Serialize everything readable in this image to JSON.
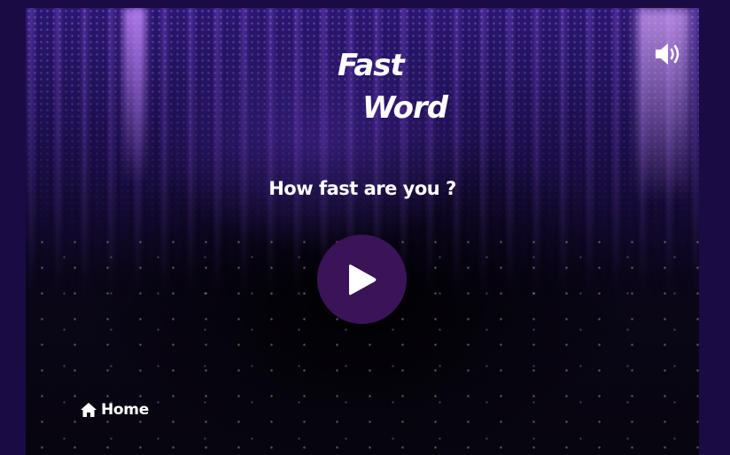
{
  "game": {
    "title_line1": "Fast",
    "title_line2": "Word",
    "tagline": "How fast are you ?"
  },
  "controls": {
    "play_icon": "play-icon",
    "sound_icon": "volume-icon",
    "home_icon": "home-icon",
    "home_label": "Home"
  },
  "colors": {
    "background": "#1a0b45",
    "play_button": "#3b1358",
    "text": "#ffffff"
  }
}
